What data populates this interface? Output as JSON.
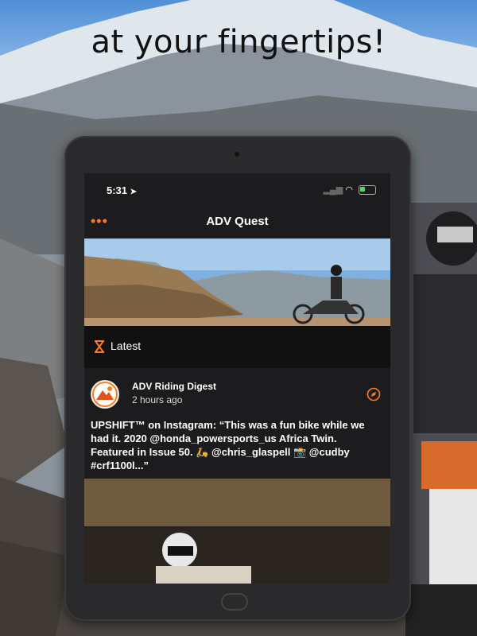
{
  "promo": {
    "tagline": "at your fingertips!"
  },
  "status_bar": {
    "time": "5:31",
    "signal": "▂▄▆",
    "wifi": "◠"
  },
  "app": {
    "title": "ADV Quest",
    "menu_glyph": "•••"
  },
  "section": {
    "label": "Latest"
  },
  "post": {
    "source": "ADV Riding Digest",
    "time_ago": "2 hours ago",
    "text": "UPSHIFT™ on Instagram: “This was a fun bike while we had it. 2020 @honda_powersports_us Africa Twin. Featured in Issue 50. 🛵 @chris_glaspell 📸 @cudby  #crf1100l...”"
  },
  "colors": {
    "accent": "#ff7a1a",
    "screen_bg": "#1c1c1e",
    "latest_bar_bg": "#111111",
    "tablet_frame": "#2a2a2c"
  },
  "icons": {
    "menu": "more-dots-icon",
    "latest": "hourglass-icon",
    "source": "compass-icon",
    "location": "location-arrow-icon",
    "battery": "battery-icon"
  }
}
